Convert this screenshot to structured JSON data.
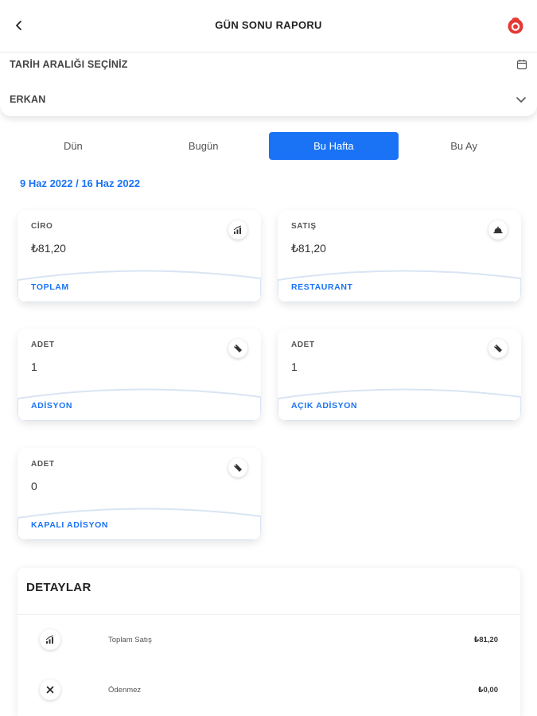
{
  "header": {
    "title": "GÜN SONU RAPORU"
  },
  "filters": {
    "date_label": "TARİH ARALIĞI SEÇİNİZ",
    "user_value": "ERKAN"
  },
  "tabs": [
    {
      "label": "Dün"
    },
    {
      "label": "Bugün"
    },
    {
      "label": "Bu Hafta"
    },
    {
      "label": "Bu Ay"
    }
  ],
  "active_tab": "Bu Hafta",
  "date_range": "9 Haz 2022 / 16 Haz 2022",
  "cards": [
    {
      "caption": "CİRO",
      "value": "₺81,20",
      "footer": "TOPLAM",
      "icon": "chart-icon"
    },
    {
      "caption": "SATIŞ",
      "value": "₺81,20",
      "footer": "RESTAURANT",
      "icon": "food-cloche-icon"
    },
    {
      "caption": "ADET",
      "value": "1",
      "footer": "ADİSYON",
      "icon": "tag-icon"
    },
    {
      "caption": "ADET",
      "value": "1",
      "footer": "AÇIK ADİSYON",
      "icon": "tag-icon"
    },
    {
      "caption": "ADET",
      "value": "0",
      "footer": "KAPALI ADİSYON",
      "icon": "tag-icon"
    }
  ],
  "details": {
    "title": "DETAYLAR",
    "rows": [
      {
        "label": "Toplam Satış",
        "value": "₺81,20",
        "icon": "chart-icon"
      },
      {
        "label": "Ödenmez",
        "value": "₺0,00",
        "icon": "close-icon"
      }
    ]
  },
  "colors": {
    "accent": "#1a73f5",
    "logo": "#e53935"
  }
}
